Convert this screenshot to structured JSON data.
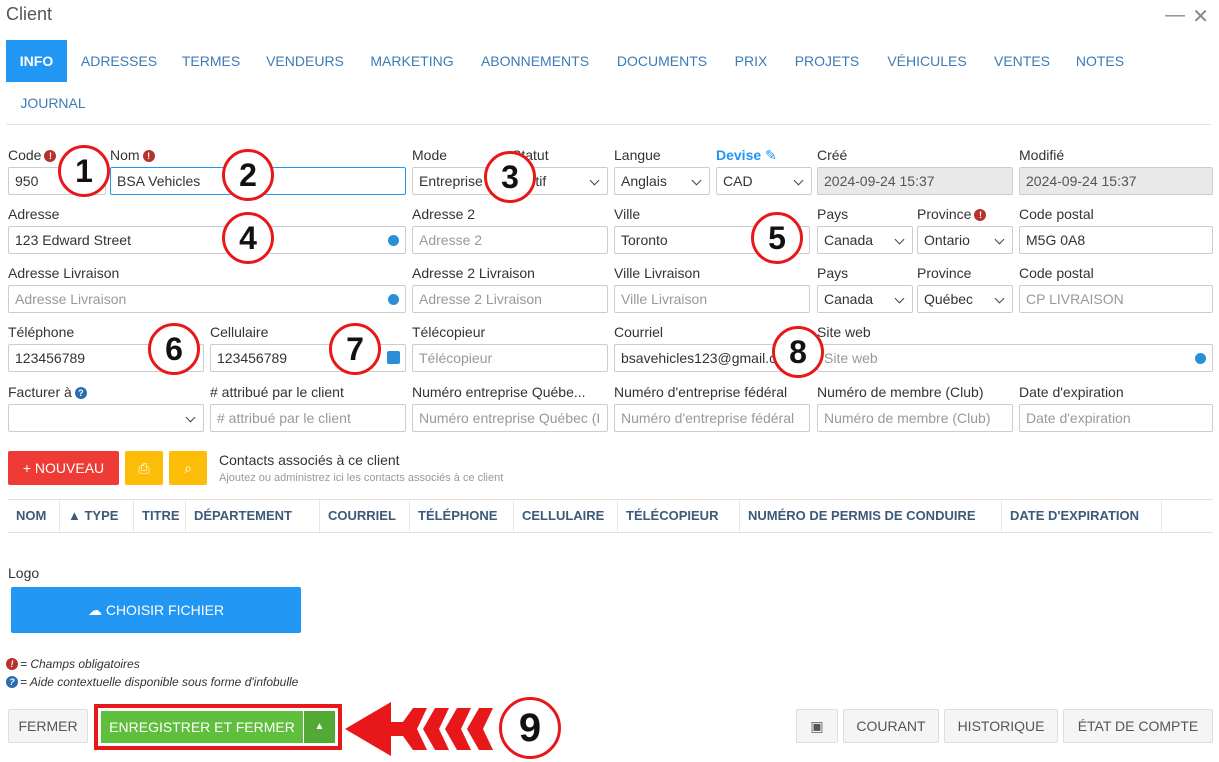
{
  "window": {
    "title": "Client",
    "minimize": "—",
    "close": "✕"
  },
  "tabs": [
    "INFO",
    "ADRESSES",
    "TERMES",
    "VENDEURS",
    "MARKETING",
    "ABONNEMENTS",
    "DOCUMENTS",
    "PRIX",
    "PROJETS",
    "VÉHICULES",
    "VENTES",
    "NOTES",
    "JOURNAL"
  ],
  "form": {
    "code": {
      "label": "Code",
      "value": "950"
    },
    "nom": {
      "label": "Nom",
      "value": "BSA Vehicles"
    },
    "mode": {
      "label": "Mode",
      "value": "Entreprise"
    },
    "statut": {
      "label": "Statut",
      "value": "Actif"
    },
    "langue": {
      "label": "Langue",
      "value": "Anglais"
    },
    "devise": {
      "label": "Devise",
      "value": "CAD"
    },
    "cree": {
      "label": "Créé",
      "value": "2024-09-24 15:37"
    },
    "modifie": {
      "label": "Modifié",
      "value": "2024-09-24 15:37"
    },
    "adresse": {
      "label": "Adresse",
      "value": "123 Edward Street"
    },
    "adresse2": {
      "label": "Adresse 2",
      "placeholder": "Adresse 2"
    },
    "ville": {
      "label": "Ville",
      "value": "Toronto"
    },
    "pays": {
      "label": "Pays",
      "value": "Canada"
    },
    "province": {
      "label": "Province",
      "value": "Ontario"
    },
    "code_postal": {
      "label": "Code postal",
      "value": "M5G 0A8"
    },
    "adresse_livraison": {
      "label": "Adresse Livraison",
      "placeholder": "Adresse Livraison"
    },
    "adresse2_livraison": {
      "label": "Adresse 2 Livraison",
      "placeholder": "Adresse 2 Livraison"
    },
    "ville_livraison": {
      "label": "Ville Livraison",
      "placeholder": "Ville Livraison"
    },
    "pays_livraison": {
      "label": "Pays",
      "value": "Canada"
    },
    "province_livraison": {
      "label": "Province",
      "value": "Québec"
    },
    "cp_livraison": {
      "label": "Code postal",
      "placeholder": "CP LIVRAISON"
    },
    "telephone": {
      "label": "Téléphone",
      "value": "123456789"
    },
    "cellulaire": {
      "label": "Cellulaire",
      "value": "123456789"
    },
    "telecopieur": {
      "label": "Télécopieur",
      "placeholder": "Télécopieur"
    },
    "courriel": {
      "label": "Courriel",
      "value": "bsavehicles123@gmail.com"
    },
    "site_web": {
      "label": "Site web",
      "placeholder": "Site web"
    },
    "facturer_a": {
      "label": "Facturer à",
      "value": ""
    },
    "num_attribue": {
      "label": "# attribué par le client",
      "placeholder": "# attribué par le client"
    },
    "num_quebec": {
      "label": "Numéro entreprise Québe...",
      "placeholder": "Numéro entreprise Québec (I"
    },
    "num_federal": {
      "label": "Numéro d'entreprise fédéral",
      "placeholder": "Numéro d'entreprise fédéral"
    },
    "num_membre": {
      "label": "Numéro de membre (Club)",
      "placeholder": "Numéro de membre (Club)"
    },
    "date_expiration": {
      "label": "Date d'expiration",
      "placeholder": "Date d'expiration"
    }
  },
  "contacts": {
    "new_button": "+ NOUVEAU",
    "title": "Contacts associés à ce client",
    "subtitle": "Ajoutez ou administrez ici les contacts associés à ce client",
    "columns": [
      "NOM",
      "▲ TYPE",
      "TITRE",
      "DÉPARTEMENT",
      "COURRIEL",
      "TÉLÉPHONE",
      "CELLULAIRE",
      "TÉLÉCOPIEUR",
      "NUMÉRO DE PERMIS DE CONDUIRE",
      "DATE D'EXPIRATION"
    ]
  },
  "logo": {
    "label": "Logo",
    "button": "CHOISIR FICHIER"
  },
  "legend": {
    "required": "= Champs obligatoires",
    "help": "= Aide contextuelle disponible sous forme d'infobulle"
  },
  "footer": {
    "close": "FERMER",
    "save": "ENREGISTRER ET FERMER",
    "courant": "COURANT",
    "historique": "HISTORIQUE",
    "etat": "ÉTAT DE COMPTE"
  },
  "callouts": [
    "1",
    "2",
    "3",
    "4",
    "5",
    "6",
    "7",
    "8",
    "9"
  ],
  "colors": {
    "accent": "#2196f3",
    "danger": "#ef3b35",
    "warning": "#fbbd08",
    "success": "#5fbe3c",
    "annotation": "#e8171a"
  }
}
